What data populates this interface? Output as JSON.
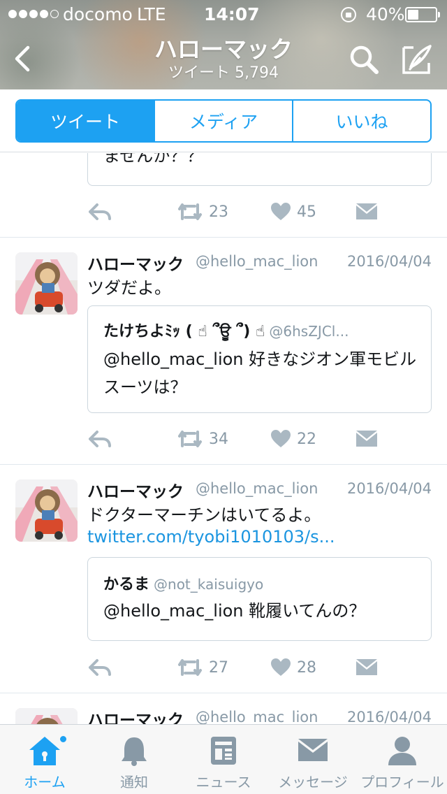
{
  "status_bar": {
    "carrier": "docomo",
    "network": "LTE",
    "time": "14:07",
    "battery_text": "40%",
    "battery_level": 0.4,
    "signal_bars_filled": 4,
    "signal_bars_total": 5
  },
  "header": {
    "title": "ハローマック",
    "subtitle": "ツイート 5,794",
    "back_icon": "chevron-left-icon",
    "search_icon": "search-icon",
    "compose_icon": "compose-icon"
  },
  "tabs": [
    {
      "label": "ツイート",
      "active": true
    },
    {
      "label": "メディア",
      "active": false
    },
    {
      "label": "いいね",
      "active": false
    }
  ],
  "colors": {
    "accent": "#1da1f2",
    "link": "#1b95e0",
    "muted": "#8899a6"
  },
  "tweets": [
    {
      "partial": true,
      "quote": {
        "text": "ませんか？？"
      },
      "retweets": "23",
      "likes": "45"
    },
    {
      "name": "ハローマック",
      "handle": "@hello_mac_lion",
      "date": "2016/04/04",
      "text": "ツダだよ。",
      "quote": {
        "name": "たけちよﾐｯ ( ☝ ՞ਊ ՞) ☝",
        "handle": "@6hsZJCl...",
        "text": "@hello_mac_lion 好きなジオン軍モビルスーツは？"
      },
      "retweets": "34",
      "likes": "22"
    },
    {
      "name": "ハローマック",
      "handle": "@hello_mac_lion",
      "date": "2016/04/04",
      "text": "ドクターマーチンはいてるよ。",
      "link": "twitter.com/tyobi1010103/s...",
      "quote": {
        "name": "かるま",
        "handle": "@not_kaisuigyo",
        "text": "@hello_mac_lion 靴履いてんの？"
      },
      "retweets": "27",
      "likes": "28"
    },
    {
      "partial": true,
      "name": "ハローマック",
      "handle": "@hello_mac_lion",
      "date": "2016/04/04"
    }
  ],
  "bottom_nav": [
    {
      "label": "ホーム",
      "icon": "home-icon",
      "active": true
    },
    {
      "label": "通知",
      "icon": "bell-icon",
      "active": false
    },
    {
      "label": "ニュース",
      "icon": "news-icon",
      "active": false
    },
    {
      "label": "メッセージ",
      "icon": "envelope-icon",
      "active": false
    },
    {
      "label": "プロフィール",
      "icon": "person-icon",
      "active": false
    }
  ]
}
